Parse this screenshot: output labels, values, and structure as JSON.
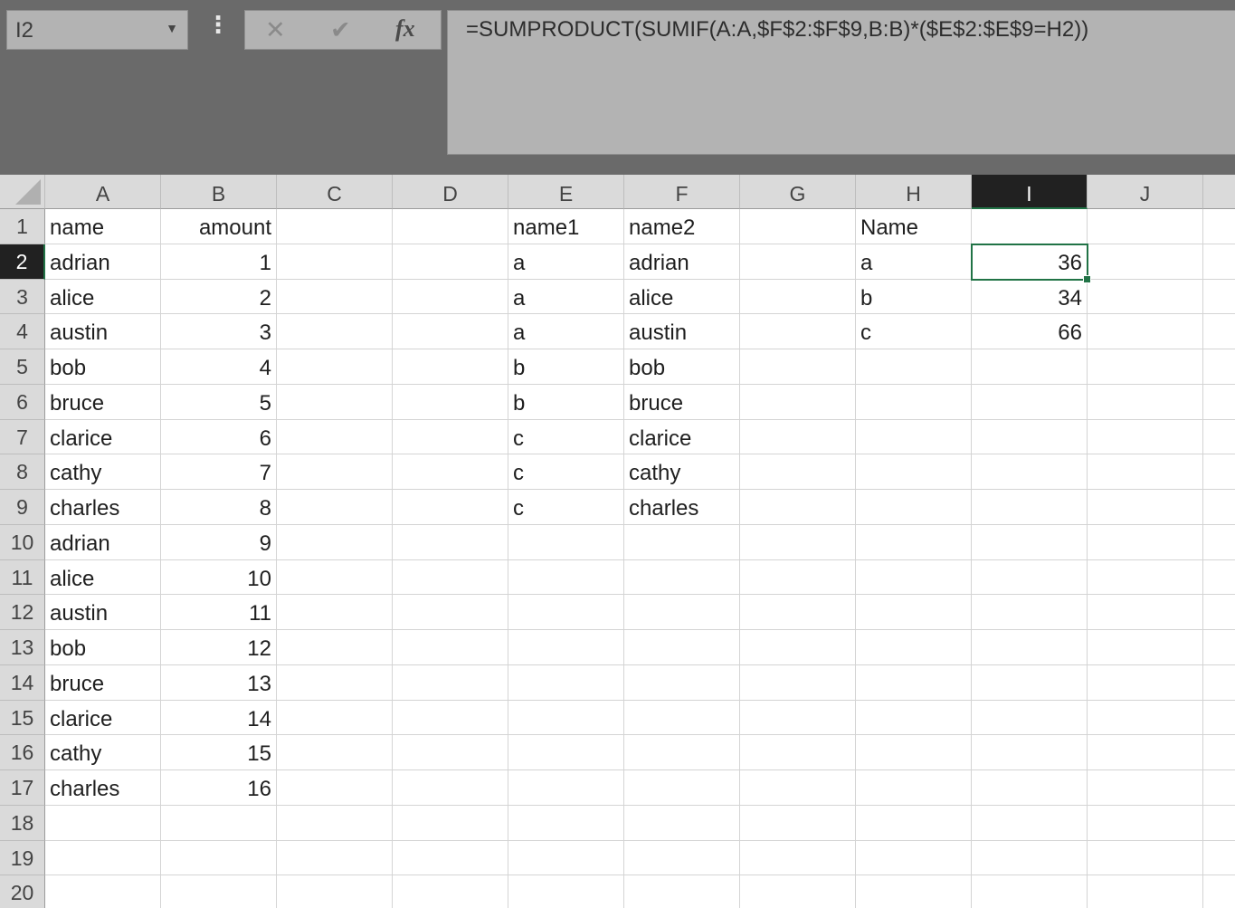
{
  "name_box": {
    "value": "I2"
  },
  "formula_bar": {
    "formula": "=SUMPRODUCT(SUMIF(A:A,$F$2:$F$9,B:B)*($E$2:$E$9=H2))"
  },
  "columns": [
    "A",
    "B",
    "C",
    "D",
    "E",
    "F",
    "G",
    "H",
    "I",
    "J"
  ],
  "selected_column": "I",
  "selected_row": 2,
  "rows": [
    {
      "n": "1",
      "A": "name",
      "B": "amount",
      "E": "name1",
      "F": "name2",
      "H": "Name"
    },
    {
      "n": "2",
      "A": "adrian",
      "B": "1",
      "E": "a",
      "F": "adrian",
      "H": "a",
      "I": "36"
    },
    {
      "n": "3",
      "A": "alice",
      "B": "2",
      "E": "a",
      "F": "alice",
      "H": "b",
      "I": "34"
    },
    {
      "n": "4",
      "A": "austin",
      "B": "3",
      "E": "a",
      "F": "austin",
      "H": "c",
      "I": "66"
    },
    {
      "n": "5",
      "A": "bob",
      "B": "4",
      "E": "b",
      "F": "bob"
    },
    {
      "n": "6",
      "A": "bruce",
      "B": "5",
      "E": "b",
      "F": "bruce"
    },
    {
      "n": "7",
      "A": "clarice",
      "B": "6",
      "E": "c",
      "F": "clarice"
    },
    {
      "n": "8",
      "A": "cathy",
      "B": "7",
      "E": "c",
      "F": "cathy"
    },
    {
      "n": "9",
      "A": "charles",
      "B": "8",
      "E": "c",
      "F": "charles"
    },
    {
      "n": "10",
      "A": "adrian",
      "B": "9"
    },
    {
      "n": "11",
      "A": "alice",
      "B": "10"
    },
    {
      "n": "12",
      "A": "austin",
      "B": "11"
    },
    {
      "n": "13",
      "A": "bob",
      "B": "12"
    },
    {
      "n": "14",
      "A": "bruce",
      "B": "13"
    },
    {
      "n": "15",
      "A": "clarice",
      "B": "14"
    },
    {
      "n": "16",
      "A": "cathy",
      "B": "15"
    },
    {
      "n": "17",
      "A": "charles",
      "B": "16"
    },
    {
      "n": "18"
    },
    {
      "n": "19"
    },
    {
      "n": "20"
    }
  ],
  "numeric_columns": [
    "B",
    "I"
  ],
  "icons": {
    "cancel": "close-icon",
    "enter": "check-icon",
    "insert_function": "fx-icon",
    "dropdown": "chevron-down-icon"
  },
  "colors": {
    "selection": "#217346",
    "header_bg": "#dadada",
    "selected_header_bg": "#212121"
  }
}
